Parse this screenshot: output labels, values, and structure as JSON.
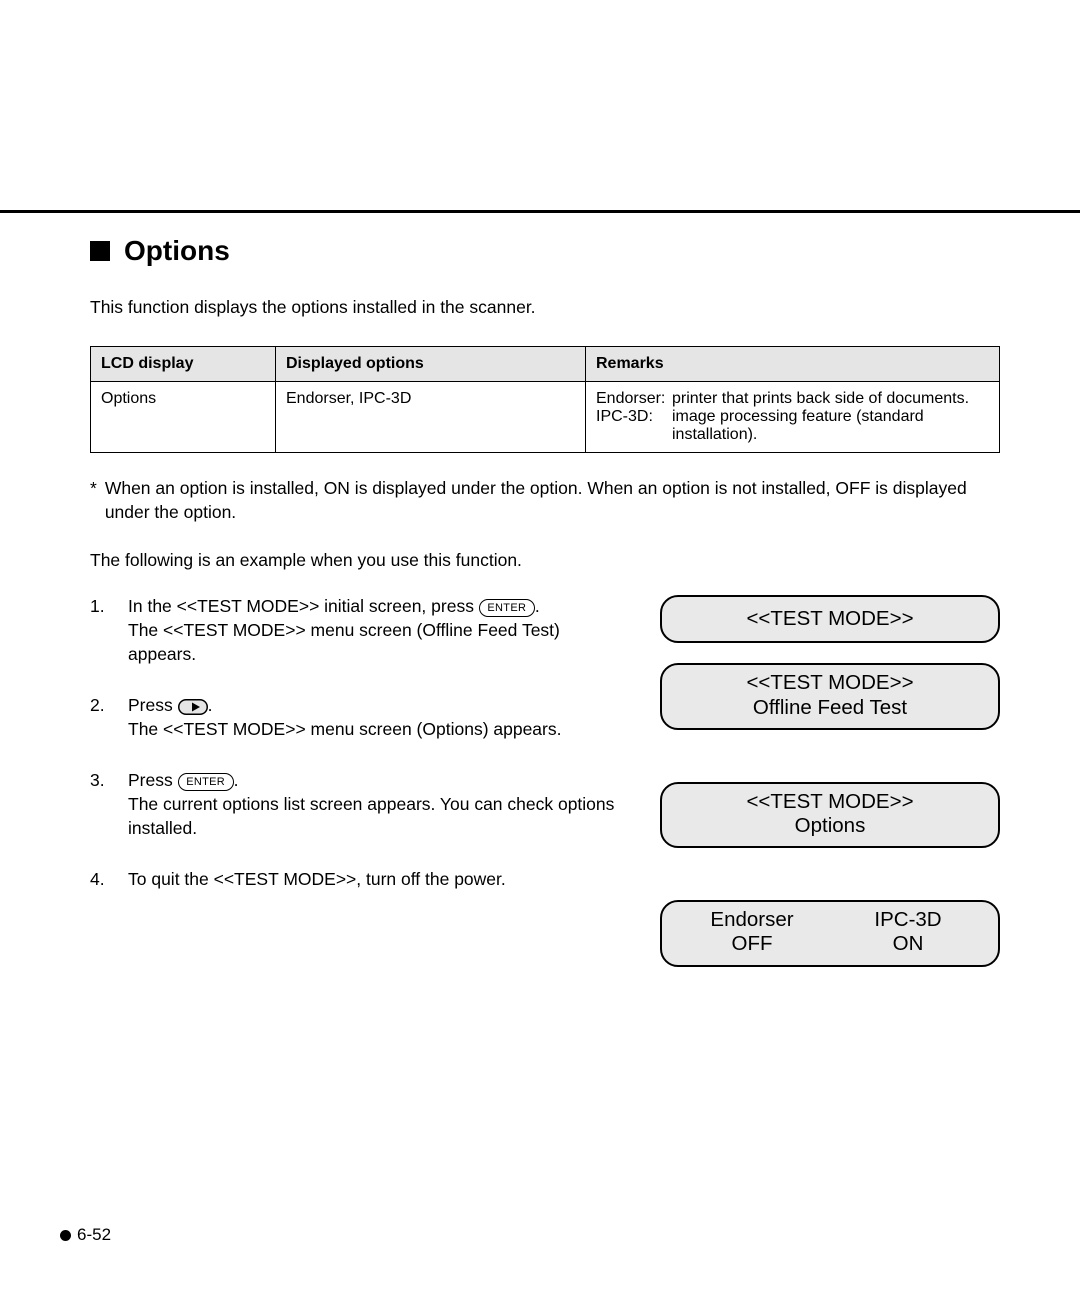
{
  "heading": "Options",
  "intro": "This function displays the options installed in the scanner.",
  "table": {
    "headers": {
      "lcd": "LCD display",
      "disp": "Displayed options",
      "rem": "Remarks"
    },
    "row": {
      "lcd": "Options",
      "disp": "Endorser, IPC-3D",
      "rem": {
        "endorser_label": "Endorser:",
        "endorser_text": "printer that prints back side of documents.",
        "ipc_label": "IPC-3D:",
        "ipc_text": "image processing feature (standard installation)."
      }
    }
  },
  "star": "*",
  "star_note": "When an option is installed, ON is displayed under the option.  When an option is not installed, OFF is displayed under the option.",
  "following": "The following is an example when you use this function.",
  "enter_label": "ENTER",
  "steps": {
    "s1a": "In the <<TEST MODE>> initial screen, press ",
    "s1b": ".",
    "s1c": "The <<TEST MODE>> menu screen (Offline Feed Test) appears.",
    "s2a": "Press ",
    "s2b": ".",
    "s2c": "The <<TEST MODE>> menu screen (Options) appears.",
    "s3a": "Press ",
    "s3b": ".",
    "s3c": "The current options list screen appears.  You can check options installed.",
    "s4": "To quit the <<TEST MODE>>, turn off the power."
  },
  "lcds": {
    "l1": "<<TEST MODE>>",
    "l2a": "<<TEST MODE>>",
    "l2b": "Offline Feed Test",
    "l3a": "<<TEST MODE>>",
    "l3b": "Options",
    "l4": {
      "c1a": "Endorser",
      "c1b": "OFF",
      "c2a": "IPC-3D",
      "c2b": "ON"
    }
  },
  "page_number": "6-52"
}
